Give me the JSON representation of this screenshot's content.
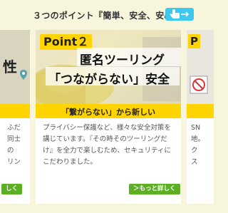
{
  "header": {
    "title": "３つのポイント『簡単、安全、安心』",
    "swipe_icon": "hand-pointer-icon"
  },
  "left_card": {
    "heading_fragment": "性",
    "text_lines": [
      "ふだ",
      "同士",
      "の",
      "リン"
    ],
    "button_label": "しく"
  },
  "main_card": {
    "point_label": "Point２",
    "title_line1": "匿名ツーリング",
    "title_line2": "「つながらない」安全",
    "subtitle": "「繋がらない」から新しい",
    "body": "プライバシー保護など、様々な安全対策を講じています。『その時そのツーリングだけ』を全力で楽しむため、セキュリティにこだわりました。",
    "button_label": "＞もっと詳しく"
  },
  "right_card": {
    "point_label": "P",
    "text_lines": [
      "SN",
      "地。",
      "ク",
      "ス"
    ]
  },
  "colors": {
    "accent_yellow": "#ffd400",
    "button_green": "#5cae22",
    "badge_blue": "#3ec8f0",
    "background": "#f7f5dc"
  }
}
